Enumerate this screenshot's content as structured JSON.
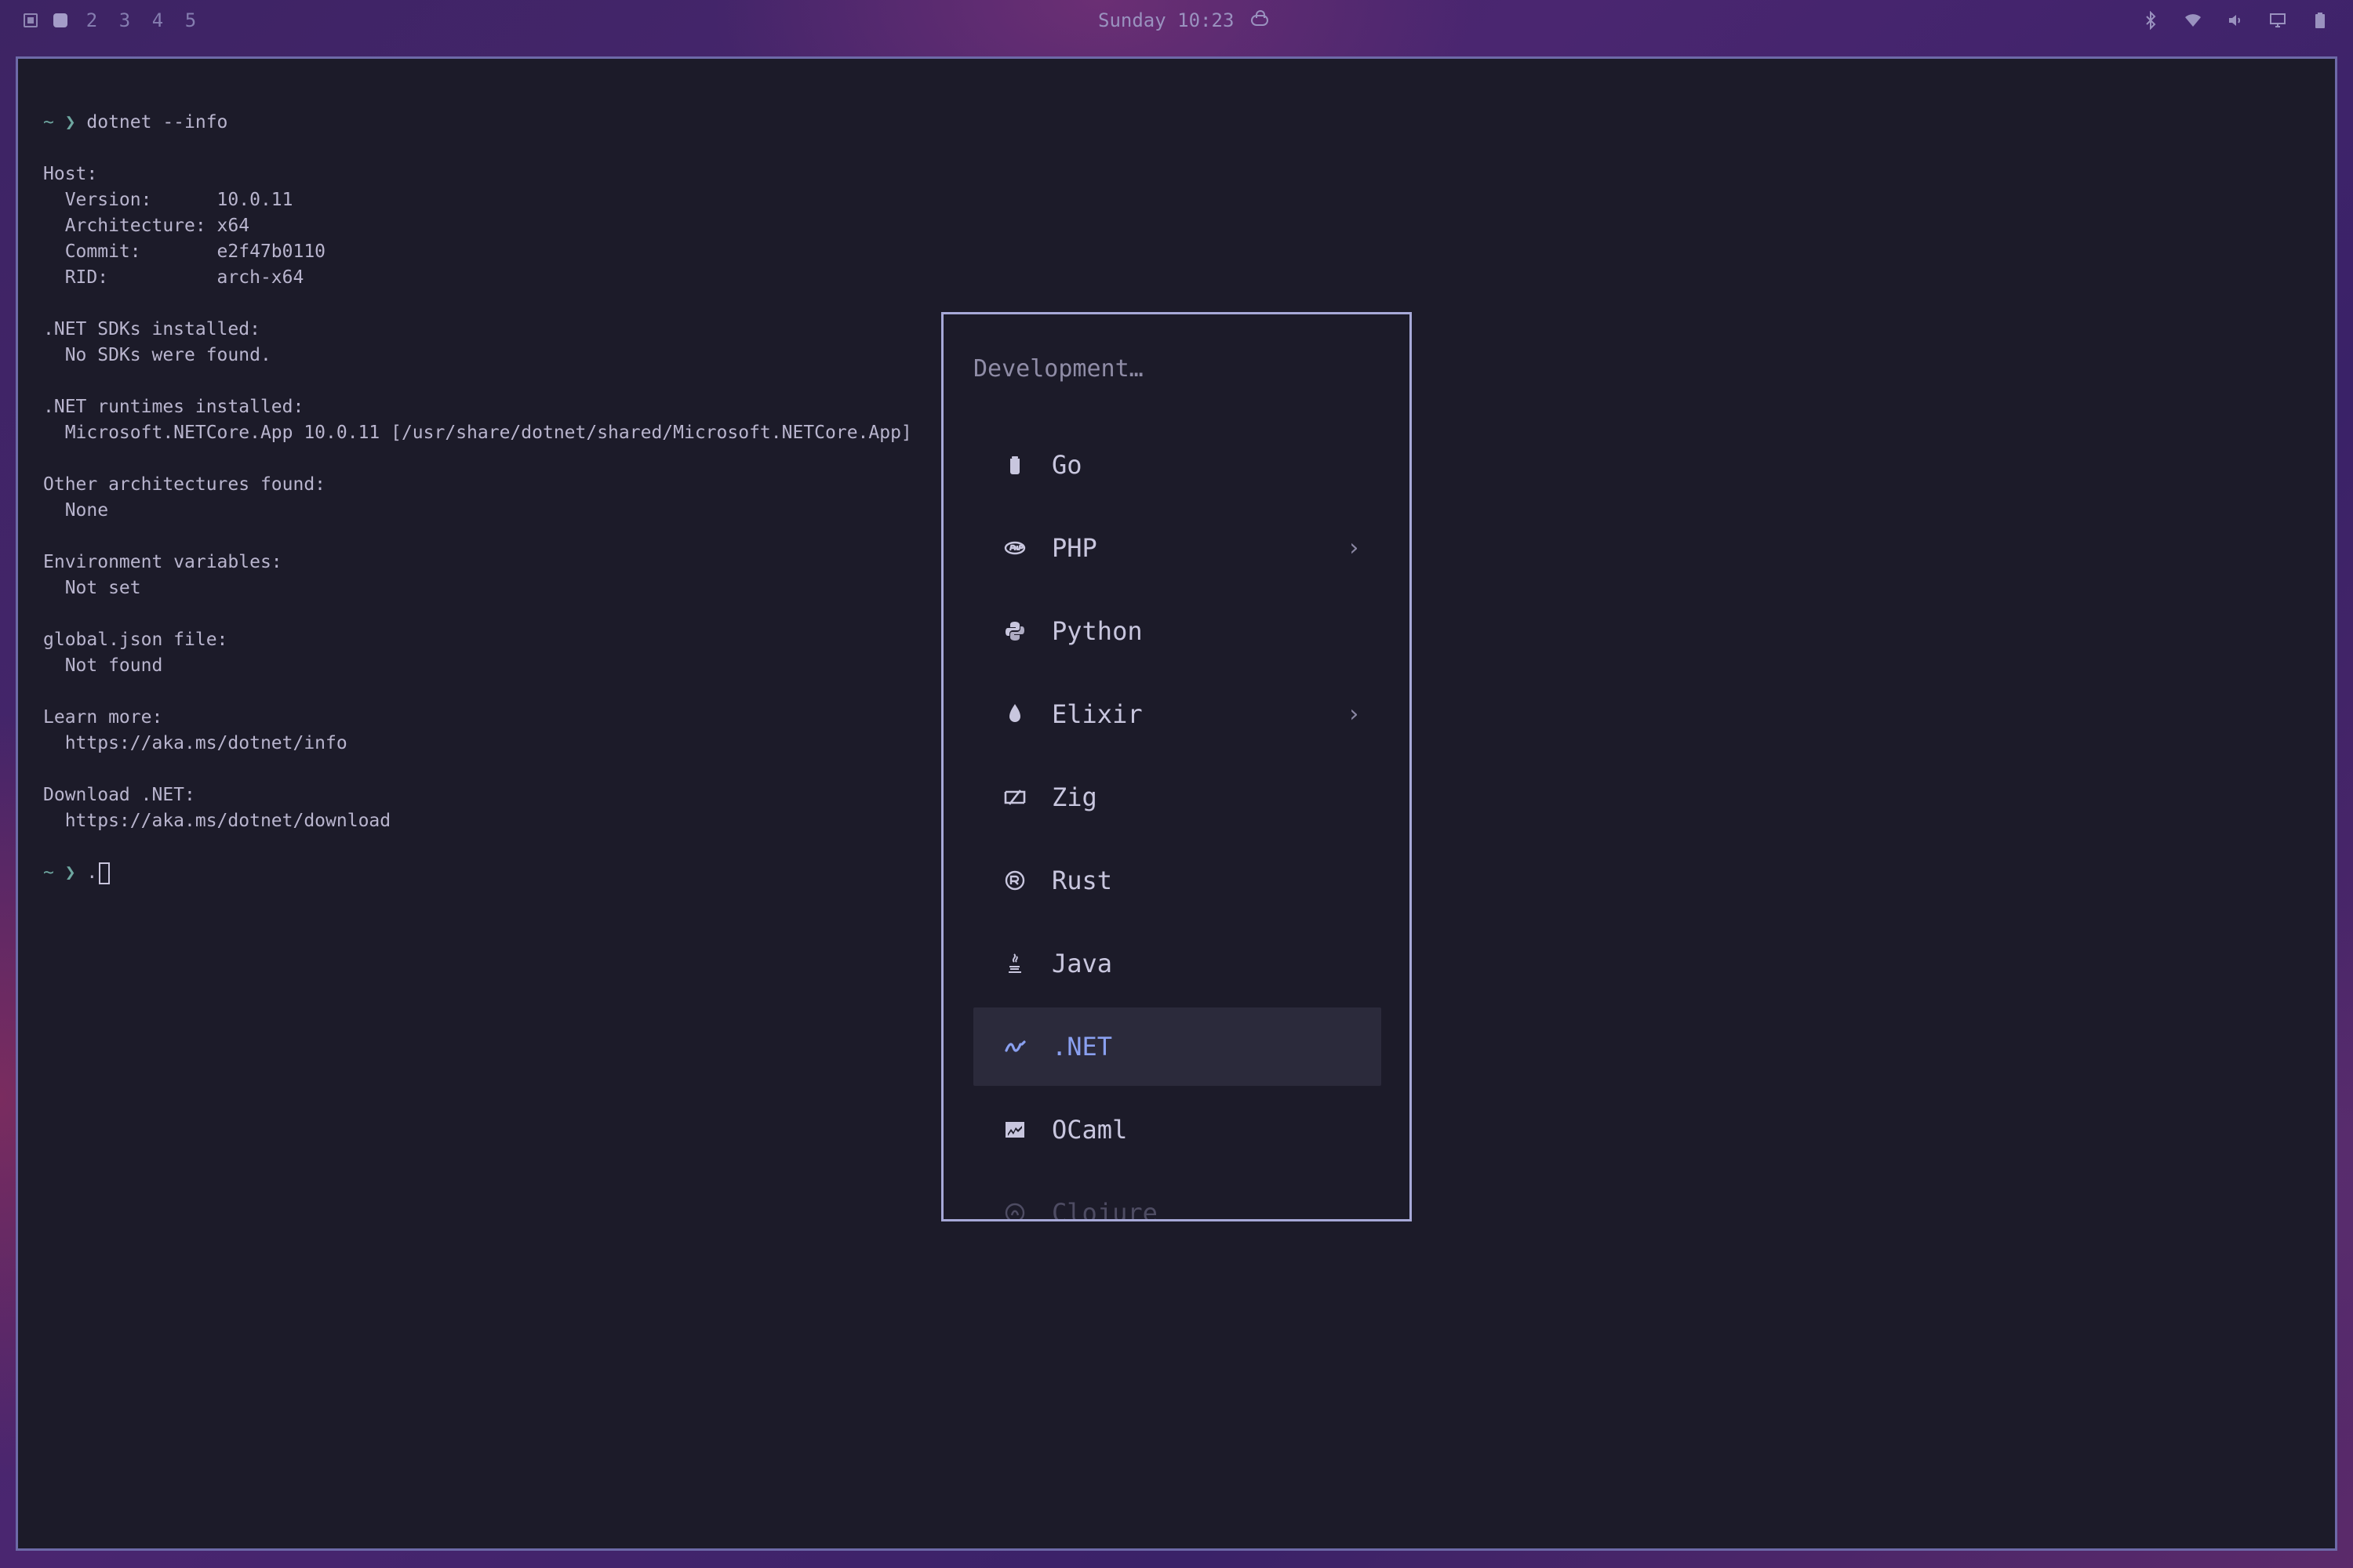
{
  "topbar": {
    "workspaces": [
      "2",
      "3",
      "4",
      "5"
    ],
    "clock": "Sunday 10:23",
    "icons": [
      "bluetooth-icon",
      "wifi-icon",
      "volume-icon",
      "display-icon",
      "battery-icon"
    ]
  },
  "terminal": {
    "lines": [
      {
        "prompt": "~ ❯ ",
        "text": "dotnet --info"
      },
      {
        "text": ""
      },
      {
        "text": "Host:"
      },
      {
        "text": "  Version:      10.0.11"
      },
      {
        "text": "  Architecture: x64"
      },
      {
        "text": "  Commit:       e2f47b0110"
      },
      {
        "text": "  RID:          arch-x64"
      },
      {
        "text": ""
      },
      {
        "text": ".NET SDKs installed:"
      },
      {
        "text": "  No SDKs were found."
      },
      {
        "text": ""
      },
      {
        "text": ".NET runtimes installed:"
      },
      {
        "text": "  Microsoft.NETCore.App 10.0.11 [/usr/share/dotnet/shared/Microsoft.NETCore.App]"
      },
      {
        "text": ""
      },
      {
        "text": "Other architectures found:"
      },
      {
        "text": "  None"
      },
      {
        "text": ""
      },
      {
        "text": "Environment variables:"
      },
      {
        "text": "  Not set"
      },
      {
        "text": ""
      },
      {
        "text": "global.json file:"
      },
      {
        "text": "  Not found"
      },
      {
        "text": ""
      },
      {
        "text": "Learn more:"
      },
      {
        "text": "  https://aka.ms/dotnet/info"
      },
      {
        "text": ""
      },
      {
        "text": "Download .NET:"
      },
      {
        "text": "  https://aka.ms/dotnet/download"
      },
      {
        "text": ""
      }
    ],
    "final_prompt": "~ ❯ ",
    "final_input": "."
  },
  "menu": {
    "title": "Development…",
    "items": [
      {
        "label": "Go",
        "icon": "go-icon",
        "submenu": false
      },
      {
        "label": "PHP",
        "icon": "php-icon",
        "submenu": true
      },
      {
        "label": "Python",
        "icon": "python-icon",
        "submenu": false
      },
      {
        "label": "Elixir",
        "icon": "elixir-icon",
        "submenu": true
      },
      {
        "label": "Zig",
        "icon": "zig-icon",
        "submenu": false
      },
      {
        "label": "Rust",
        "icon": "rust-icon",
        "submenu": false
      },
      {
        "label": "Java",
        "icon": "java-icon",
        "submenu": false
      },
      {
        "label": ".NET",
        "icon": "dotnet-icon",
        "submenu": false,
        "selected": true
      },
      {
        "label": "OCaml",
        "icon": "ocaml-icon",
        "submenu": false
      },
      {
        "label": "Clojure",
        "icon": "clojure-icon",
        "submenu": false,
        "faded": true
      }
    ],
    "submenu_glyph": "›"
  },
  "colors": {
    "terminal_bg": "#1c1b29",
    "border": "#6d6aa8",
    "menu_border": "#a7a9d8",
    "selected_bg": "#2b2a3b",
    "selected_fg": "#8aa0f0",
    "prompt": "#6ea7a0"
  }
}
